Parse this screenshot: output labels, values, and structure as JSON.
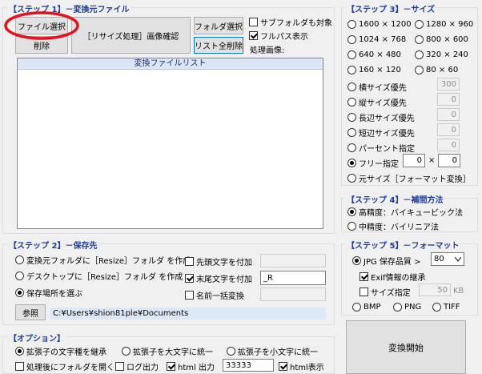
{
  "step1": {
    "title": "【ステップ 1】－変換元ファイル",
    "file_select": "ファイル選択",
    "delete": "削除",
    "resize_confirm": "［リサイズ処理］画像確認",
    "folder_select": "フォルダ選択",
    "list_clear": "リスト全削除",
    "subfolder": "サブフォルダも対象",
    "fullpath": "フルパス表示",
    "processing_label": "処理画像:",
    "list_header": "変換ファイルリスト"
  },
  "step2": {
    "title": "【ステップ 2】－保存先",
    "opt_source": "変換元フォルダに［Resize］フォルダ を作成",
    "opt_desktop": "デスクトップに［Resize］フォルダ を作成",
    "opt_choose": "保存場所を選ぶ",
    "prefix": "先頭文字を付加",
    "suffix": "末尾文字を付加",
    "suffix_value": "_R",
    "rename": "名前一括変換",
    "browse": "参照",
    "path": "C:¥Users¥shion81ple¥Documents"
  },
  "options": {
    "title": "【オプション】",
    "ext_keep": "拡張子の文字種を継承",
    "ext_upper": "拡張子を大文字に統一",
    "ext_lower": "拡張子を小文字に統一",
    "open_folder": "処理後にフォルダを開く",
    "log": "ログ出力",
    "html": "html 出力",
    "html_value": "33333",
    "html_show": "html表示"
  },
  "step3": {
    "title": "【ステップ 3】－サイズ",
    "s1": "1600 × 1200",
    "s2": "1280 × 960",
    "s3": "1024 × 768",
    "s4": "800 × 600",
    "s5": "640 × 480",
    "s6": "320 × 240",
    "s7": "160 × 120",
    "s8": "80 × 60",
    "width_pri": "横サイズ優先",
    "width_val": "300",
    "height_pri": "縦サイズ優先",
    "height_val": "0",
    "long_pri": "長辺サイズ優先",
    "long_val": "0",
    "short_pri": "短辺サイズ優先",
    "short_val": "0",
    "percent": "パーセント指定",
    "percent_val": "0",
    "free": "フリー指定",
    "free_w": "0",
    "times": "×",
    "free_h": "0",
    "original": "元サイズ［フォーマット変換］"
  },
  "step4": {
    "title": "【ステップ 4】－補間方法",
    "high": "高精度：バイキュービック法",
    "mid": "中精度：バイリニア法"
  },
  "step5": {
    "title": "【ステップ 5】－フォーマット",
    "jpg": "JPG 保存品質 >",
    "quality": "80",
    "exif": "Exif情報の継承",
    "size_spec": "サイズ指定",
    "size_val": "50",
    "size_unit": "KB",
    "bmp": "BMP",
    "png": "PNG",
    "tiff": "TIFF",
    "start": "変換開始"
  },
  "colors": {
    "title": "#1e3c9a",
    "accent": "#0078d7",
    "annotation": "#e0141e",
    "list_header": "#dde6f7"
  }
}
